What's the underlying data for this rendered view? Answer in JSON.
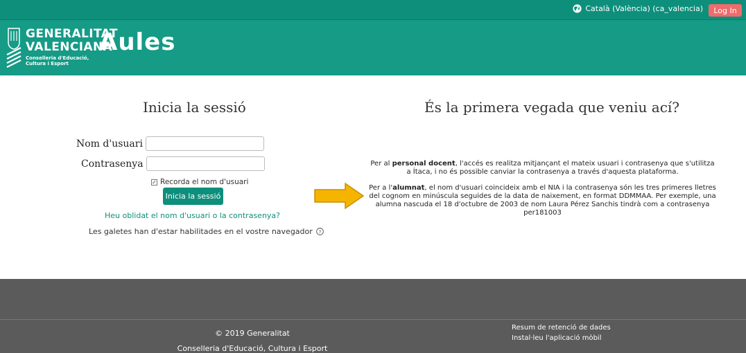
{
  "topbar": {
    "language": "Català (València) (ca_valencia)",
    "login_label": "Log In"
  },
  "header": {
    "org_line1": "GENERALITAT",
    "org_line2": "VALENCIANA",
    "org_sub1": "Conselleria d'Educació,",
    "org_sub2": "Cultura i Esport",
    "app_name": "Aules"
  },
  "login": {
    "title": "Inicia la sessió",
    "username_label": "Nom d'usuari",
    "password_label": "Contrasenya",
    "remember_label": "Recorda el nom d'usuari",
    "submit_label": "Inicia la sessió",
    "forgot_link": "Heu oblidat el nom d'usuari o la contrasenya?",
    "cookies_notice": "Les galetes han d'estar habilitades en el vostre navegador"
  },
  "info": {
    "title": "És la primera vegada que veniu ací?",
    "p1_pre": "Per al ",
    "p1_bold": "personal docent",
    "p1_post": ", l'accés es realitza mitjançant el mateix usuari i contrasenya que s'utilitza a Ítaca, i no és possible canviar la contrasenya a través d'aquesta plataforma.",
    "p2_pre": "Per a l'",
    "p2_bold": "alumnat",
    "p2_post": ", el nom d'usuari coincideix amb el NIA i la contrasenya són les tres primeres lletres del cognom en minúscula seguides de la data de naixement, en format DDMMAA. Per exemple, una alumna nascuda el 18 d'octubre de 2003 de nom Laura Pérez Sanchis tindrà com a contrasenya per181003"
  },
  "footer": {
    "copyright": "© 2019 Generalitat",
    "department": "Conselleria d'Educació, Cultura i Esport",
    "data_retention": "Resum de retenció de dades",
    "mobile_app": "Instal·leu l'aplicació mòbil"
  },
  "colors": {
    "brand": "#159b86",
    "topbar": "#0e8f7c",
    "login_button": "#f06b6b",
    "arrow": "#f5b400",
    "footer": "#5b5b5b"
  },
  "icons": [
    "globe-icon",
    "generalitat-shield-icon",
    "checkbox-checked-icon",
    "help-icon",
    "arrow-right-icon"
  ]
}
